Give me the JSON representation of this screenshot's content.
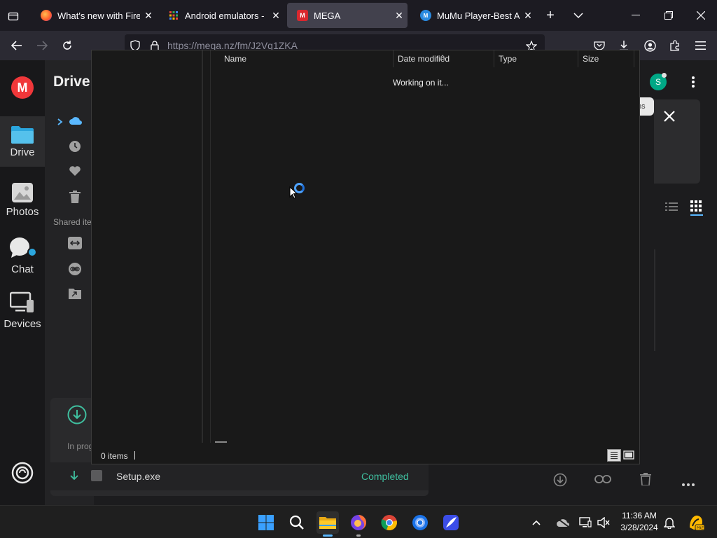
{
  "browser": {
    "tabs": [
      {
        "title": "What's new with Firefo",
        "favicon": "firefox-icon",
        "active": false
      },
      {
        "title": "Android emulators - En",
        "favicon": "emulator-icon",
        "active": false
      },
      {
        "title": "MEGA",
        "favicon": "mega-icon",
        "active": true
      },
      {
        "title": "MuMu Player-Best An",
        "favicon": "mumu-icon",
        "active": false
      }
    ],
    "url": "https://mega.nz/fm/J2Vq1ZKA"
  },
  "mega": {
    "logo_letter": "M",
    "drive_title": "Drive",
    "rail": [
      {
        "label": "Drive",
        "icon": "folder-icon"
      },
      {
        "label": "Photos",
        "icon": "photos-icon"
      },
      {
        "label": "Chat",
        "icon": "chat-icon"
      },
      {
        "label": "Devices",
        "icon": "devices-icon"
      }
    ],
    "shared_label": "Shared ite",
    "avatar_letter": "S",
    "tooltip_fragment": "ns",
    "transfer": {
      "in_progress_label": "In prog",
      "file_name": "Setup.exe",
      "status": "Completed"
    }
  },
  "dialog": {
    "columns": [
      "Name",
      "Date modified",
      "Type",
      "Size"
    ],
    "working_text": "Working on it...",
    "status_items": "0 items"
  },
  "taskbar": {
    "time": "11:36 AM",
    "date": "3/28/2024"
  },
  "colors": {
    "mega_red": "#f0373a",
    "accent_blue": "#4fa3ff",
    "completed_green": "#3fbf9f"
  }
}
